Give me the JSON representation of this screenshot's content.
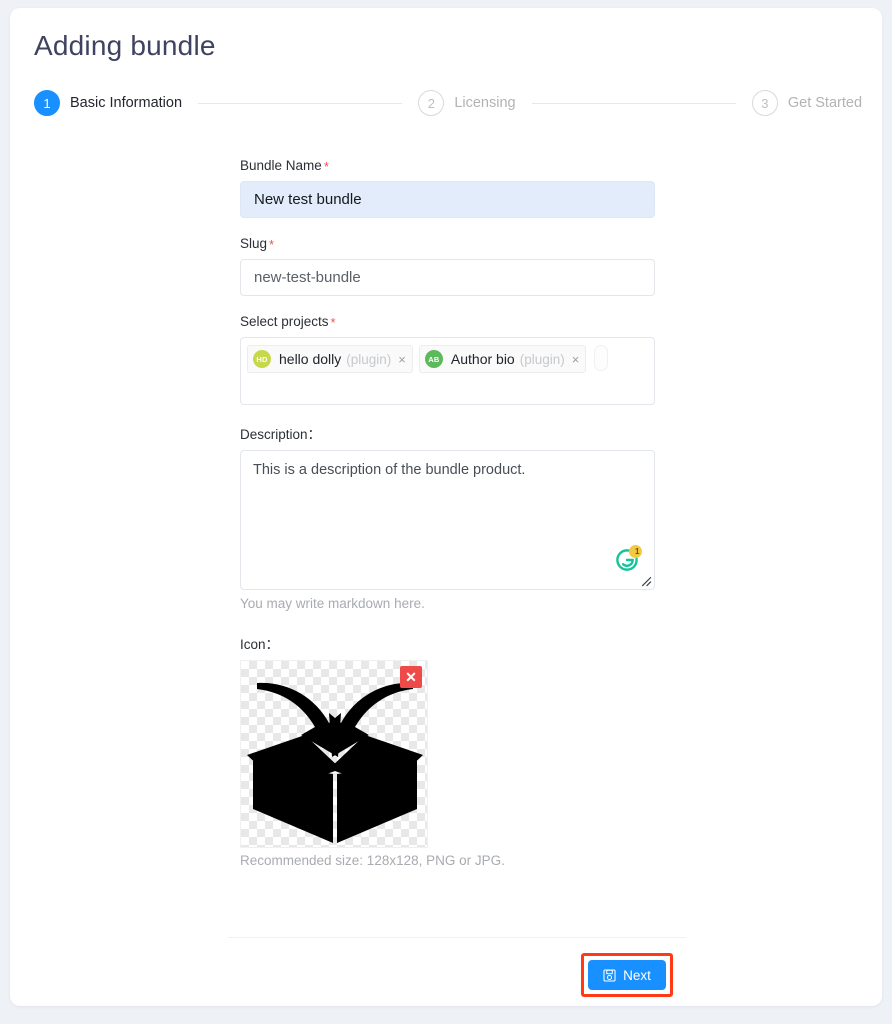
{
  "header": {
    "title": "Adding bundle"
  },
  "steps": [
    {
      "number": "1",
      "label": "Basic Information",
      "state": "active"
    },
    {
      "number": "2",
      "label": "Licensing",
      "state": "inactive"
    },
    {
      "number": "3",
      "label": "Get Started",
      "state": "inactive"
    }
  ],
  "form": {
    "bundle_name": {
      "label": "Bundle Name",
      "required_mark": "*",
      "value": "New test bundle"
    },
    "slug": {
      "label": "Slug",
      "required_mark": "*",
      "value": "new-test-bundle"
    },
    "select_projects": {
      "label": "Select projects",
      "required_mark": "*",
      "chips": [
        {
          "initials": "HD",
          "name": "hello dolly",
          "kind": "(plugin)",
          "remove": "×",
          "color": "#c5d94b"
        },
        {
          "initials": "AB",
          "name": "Author bio",
          "kind": "(plugin)",
          "remove": "×",
          "color": "#5cba5c"
        }
      ]
    },
    "description": {
      "label": "Description：",
      "value": "This is a description of the bundle product.",
      "helper": "You may write markdown here.",
      "grammarly_badge_count": "1"
    },
    "icon": {
      "label": "Icon：",
      "delete_label": "✕",
      "caption": "Recommended size: 128x128, PNG or JPG."
    }
  },
  "footer": {
    "next_label": "Next"
  },
  "colors": {
    "accent_blue": "#1890ff",
    "required_red": "#ff4d4f",
    "highlight_red": "#ff3b17",
    "delete_red": "#ef4a4a",
    "page_bg": "#eef1f6",
    "title": "#3f4360",
    "grammarly_green": "#15c39a",
    "grammarly_badge": "#f5c842"
  }
}
